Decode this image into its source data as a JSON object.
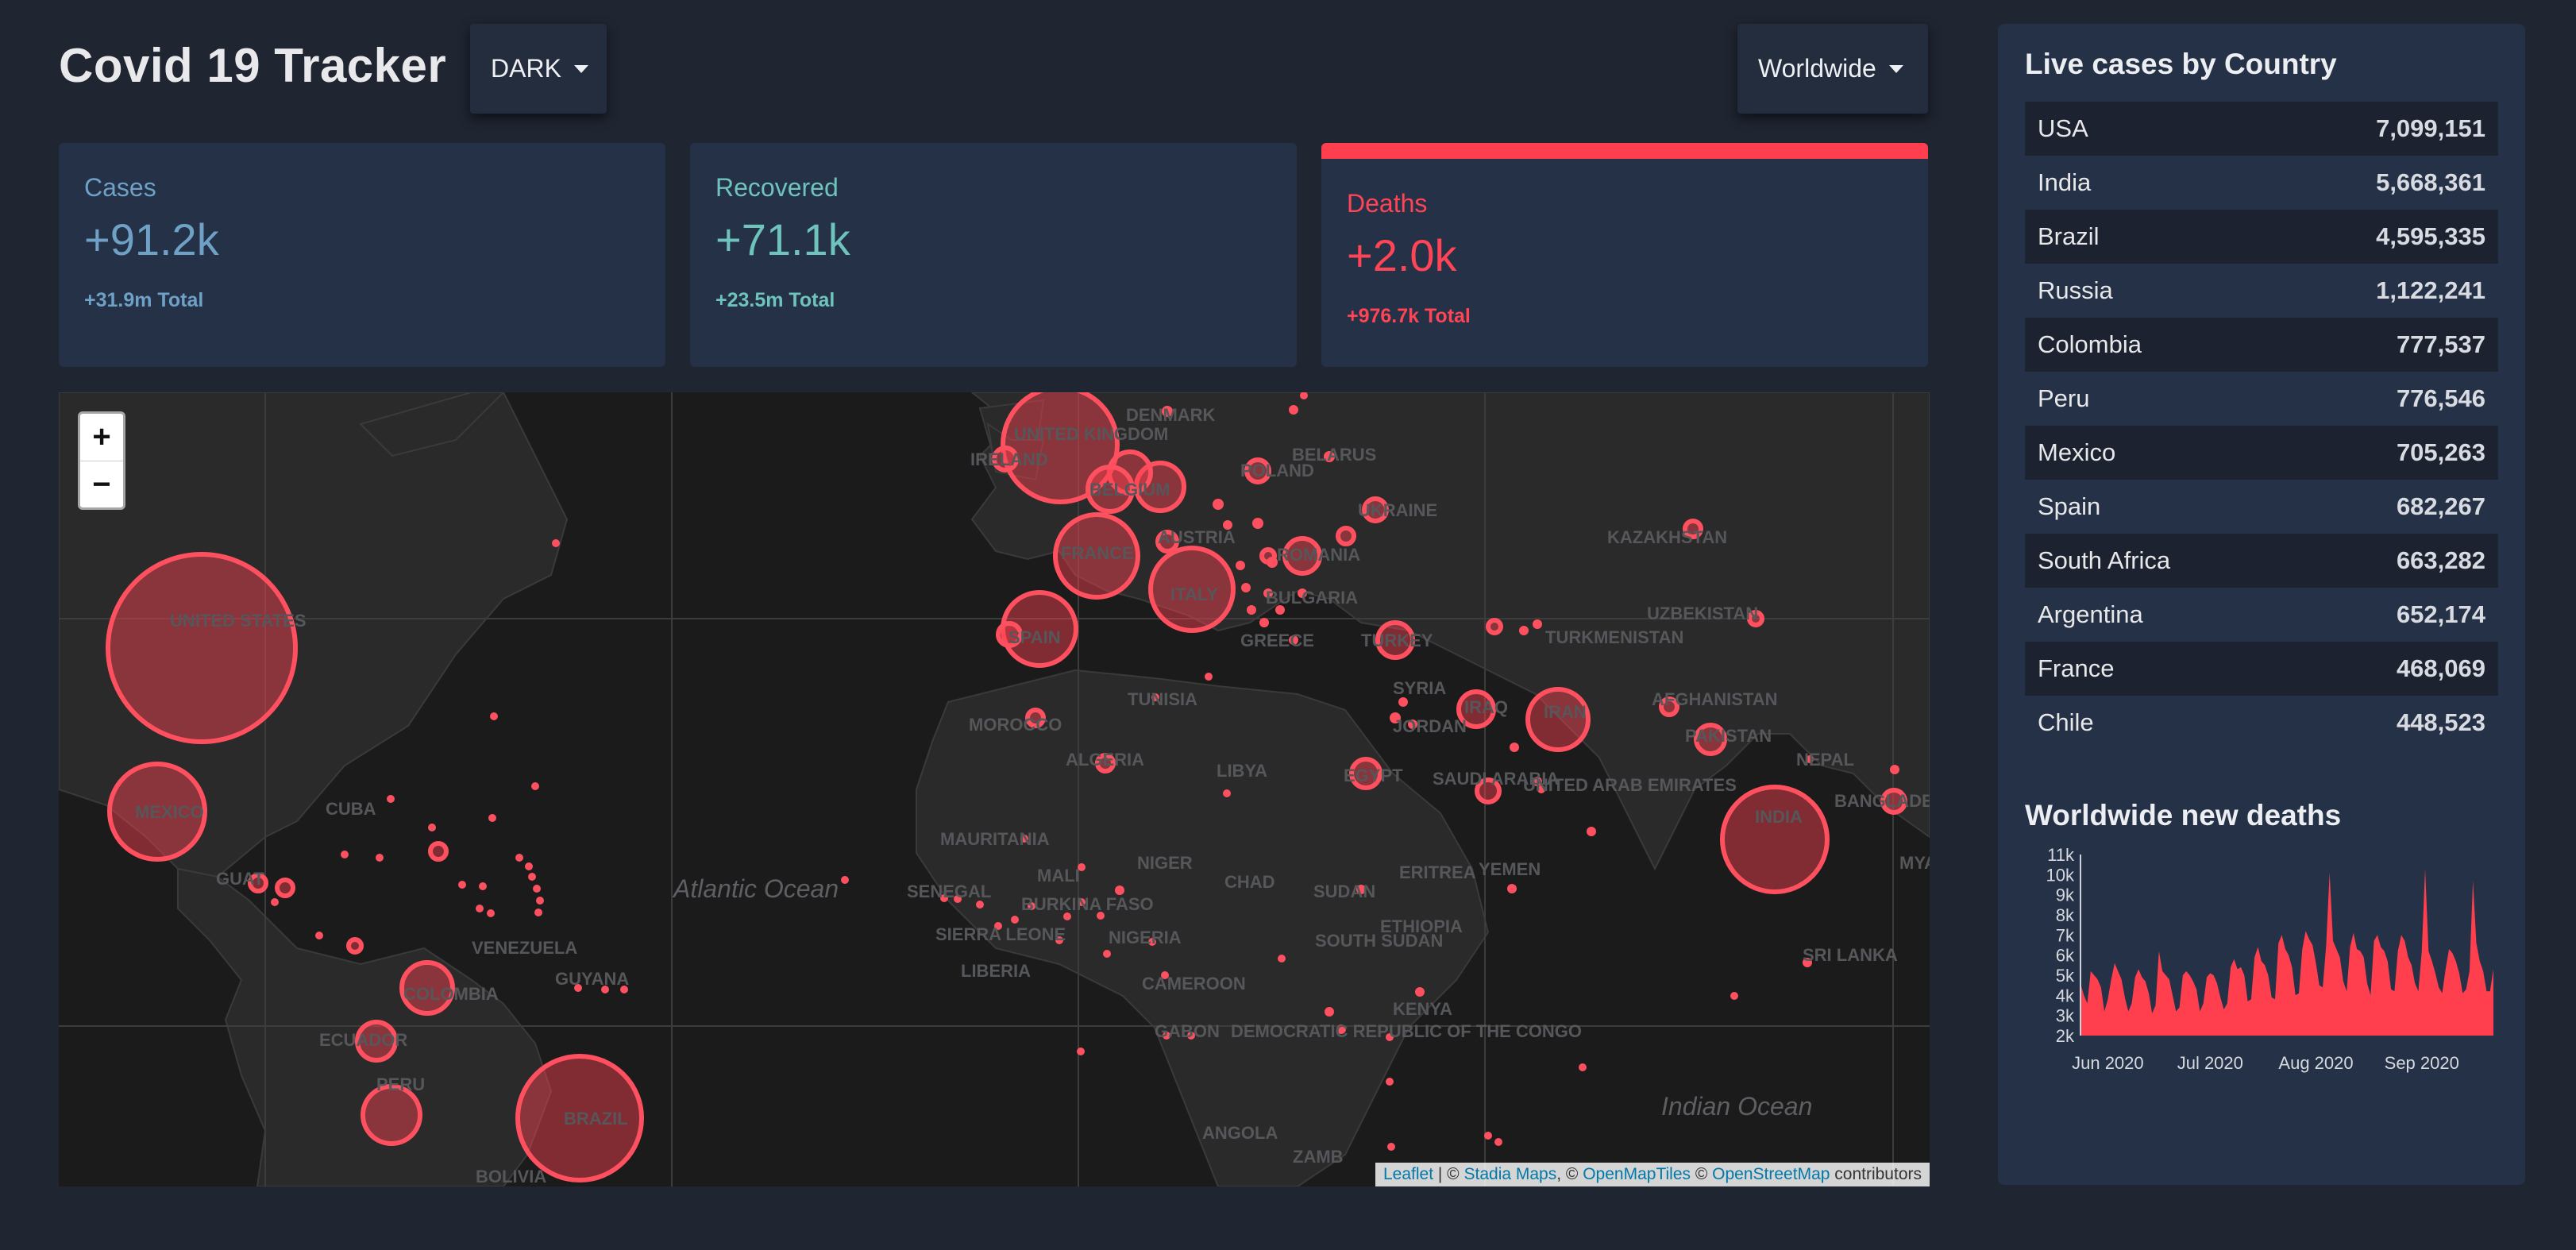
{
  "header": {
    "title": "Covid 19 Tracker",
    "theme_label": "DARK",
    "region_label": "Worldwide"
  },
  "stats": [
    {
      "title": "Cases",
      "value": "+91.2k",
      "total": "+31.9m Total",
      "color": "#6fa1c6"
    },
    {
      "title": "Recovered",
      "value": "+71.1k",
      "total": "+23.5m Total",
      "color": "#6fc3bd"
    },
    {
      "title": "Deaths",
      "value": "+2.0k",
      "total": "+976.7k Total",
      "color": "#ff4455",
      "active": true
    }
  ],
  "map": {
    "zoom_in": "+",
    "zoom_out": "−",
    "attribution": {
      "leaflet": "Leaflet",
      "sep1": " | © ",
      "stadia": "Stadia Maps",
      "sep2": ", © ",
      "openmaptiles": "OpenMapTiles",
      "sep3": " © ",
      "osm": "OpenStreetMap",
      "suffix": " contributors"
    },
    "labels": {
      "us": "UNITED STATES",
      "mexico": "MEXICO",
      "cuba": "CUBA",
      "guatemala": "GUAT",
      "venezuela": "VENEZUELA",
      "guyana": "GUYANA",
      "colombia": "COLOMBIA",
      "ecuador": "ECUADOR",
      "peru": "PERU",
      "brazil": "BRAZIL",
      "bolivia": "BOLIVIA",
      "atlantic": "Atlantic Ocean",
      "indian": "Indian Ocean",
      "uk": "UNITED KINGDOM",
      "ireland": "IRELAND",
      "denmark": "DENMARK",
      "belgium": "BELGIUM",
      "poland": "POLAND",
      "belarus": "BELARUS",
      "ukraine": "UKRAINE",
      "france": "FRANCE",
      "austria": "AUSTRIA",
      "romania": "ROMANIA",
      "italy": "ITALY",
      "bulgaria": "BULGARIA",
      "spain": "SPAIN",
      "greece": "GREECE",
      "turkey": "TURKEY",
      "syria": "SYRIA",
      "iraq": "IRAQ",
      "iran": "IRAN",
      "jordan": "JORDAN",
      "morocco": "MOROCCO",
      "tunisia": "TUNISIA",
      "algeria": "ALGERIA",
      "libya": "LIBYA",
      "egypt": "EGYPT",
      "saudi": "SAUDI ARABIA",
      "uae": "UNITED ARAB EMIRATES",
      "yemen": "YEMEN",
      "eritrea": "ERITREA",
      "mauritania": "MAURITANIA",
      "mali": "MALI",
      "niger": "NIGER",
      "chad": "CHAD",
      "sudan": "SUDAN",
      "senegal": "SENEGAL",
      "burkina": "BURKINA FASO",
      "sierra": "SIERRA LEONE",
      "liberia": "LIBERIA",
      "nigeria": "NIGERIA",
      "southsudan": "SOUTH SUDAN",
      "ethiopia": "ETHIOPIA",
      "cameroon": "CAMEROON",
      "gabon": "GABON",
      "drc": "DEMOCRATIC REPUBLIC OF THE CONGO",
      "kenya": "KENYA",
      "angola": "ANGOLA",
      "zambia": "ZAMB",
      "kazakhstan": "KAZAKHSTAN",
      "uzbekistan": "UZBEKISTAN",
      "turkmenistan": "TURKMENISTAN",
      "afghanistan": "AFGHANISTAN",
      "pakistan": "PAKISTAN",
      "nepal": "NEPAL",
      "india": "INDIA",
      "bangladesh": "BANGLADESH",
      "srilanka": "SRI LANKA",
      "myanmar": "MYA"
    }
  },
  "sidebar": {
    "title": "Live cases by Country",
    "countries": [
      {
        "name": "USA",
        "cases": "7,099,151"
      },
      {
        "name": "India",
        "cases": "5,668,361"
      },
      {
        "name": "Brazil",
        "cases": "4,595,335"
      },
      {
        "name": "Russia",
        "cases": "1,122,241"
      },
      {
        "name": "Colombia",
        "cases": "777,537"
      },
      {
        "name": "Peru",
        "cases": "776,546"
      },
      {
        "name": "Mexico",
        "cases": "705,263"
      },
      {
        "name": "Spain",
        "cases": "682,267"
      },
      {
        "name": "South Africa",
        "cases": "663,282"
      },
      {
        "name": "Argentina",
        "cases": "652,174"
      },
      {
        "name": "France",
        "cases": "468,069"
      },
      {
        "name": "Chile",
        "cases": "448,523"
      }
    ],
    "chart_title": "Worldwide new deaths"
  },
  "colors": {
    "accent": "#ff3f4e",
    "background": "#1f2531",
    "panel": "#243147"
  },
  "chart_data": {
    "type": "area",
    "title": "Worldwide new deaths",
    "xlabel": "",
    "ylabel": "",
    "x_ticks": [
      "Jun 2020",
      "Jul 2020",
      "Aug 2020",
      "Sep 2020"
    ],
    "y_ticks": [
      "2k",
      "3k",
      "4k",
      "5k",
      "6k",
      "7k",
      "8k",
      "9k",
      "10k",
      "11k"
    ],
    "ylim": [
      2000,
      11000
    ],
    "x": [
      "2020-05-24",
      "2020-05-25",
      "2020-05-26",
      "2020-05-27",
      "2020-05-28",
      "2020-05-29",
      "2020-05-30",
      "2020-05-31",
      "2020-06-01",
      "2020-06-02",
      "2020-06-03",
      "2020-06-04",
      "2020-06-05",
      "2020-06-06",
      "2020-06-07",
      "2020-06-08",
      "2020-06-09",
      "2020-06-10",
      "2020-06-11",
      "2020-06-12",
      "2020-06-13",
      "2020-06-14",
      "2020-06-15",
      "2020-06-16",
      "2020-06-17",
      "2020-06-18",
      "2020-06-19",
      "2020-06-20",
      "2020-06-21",
      "2020-06-22",
      "2020-06-23",
      "2020-06-24",
      "2020-06-25",
      "2020-06-26",
      "2020-06-27",
      "2020-06-28",
      "2020-06-29",
      "2020-06-30",
      "2020-07-01",
      "2020-07-02",
      "2020-07-03",
      "2020-07-04",
      "2020-07-05",
      "2020-07-06",
      "2020-07-07",
      "2020-07-08",
      "2020-07-09",
      "2020-07-10",
      "2020-07-11",
      "2020-07-12",
      "2020-07-13",
      "2020-07-14",
      "2020-07-15",
      "2020-07-16",
      "2020-07-17",
      "2020-07-18",
      "2020-07-19",
      "2020-07-20",
      "2020-07-21",
      "2020-07-22",
      "2020-07-23",
      "2020-07-24",
      "2020-07-25",
      "2020-07-26",
      "2020-07-27",
      "2020-07-28",
      "2020-07-29",
      "2020-07-30",
      "2020-07-31",
      "2020-08-01",
      "2020-08-02",
      "2020-08-03",
      "2020-08-04",
      "2020-08-05",
      "2020-08-06",
      "2020-08-07",
      "2020-08-08",
      "2020-08-09",
      "2020-08-10",
      "2020-08-11",
      "2020-08-12",
      "2020-08-13",
      "2020-08-14",
      "2020-08-15",
      "2020-08-16",
      "2020-08-17",
      "2020-08-18",
      "2020-08-19",
      "2020-08-20",
      "2020-08-21",
      "2020-08-22",
      "2020-08-23",
      "2020-08-24",
      "2020-08-25",
      "2020-08-26",
      "2020-08-27",
      "2020-08-28",
      "2020-08-29",
      "2020-08-30",
      "2020-08-31",
      "2020-09-01",
      "2020-09-02",
      "2020-09-03",
      "2020-09-04",
      "2020-09-05",
      "2020-09-06",
      "2020-09-07",
      "2020-09-08",
      "2020-09-09",
      "2020-09-10",
      "2020-09-11",
      "2020-09-12",
      "2020-09-13",
      "2020-09-14",
      "2020-09-15",
      "2020-09-16",
      "2020-09-17",
      "2020-09-18",
      "2020-09-19",
      "2020-09-20",
      "2020-09-21",
      "2020-09-22"
    ],
    "values": [
      4600,
      4000,
      3600,
      5200,
      5000,
      4800,
      4400,
      3200,
      3800,
      4800,
      5600,
      5200,
      4800,
      3900,
      3200,
      3600,
      4900,
      5300,
      4900,
      4700,
      4100,
      3100,
      3500,
      6200,
      5200,
      5000,
      4800,
      4000,
      3200,
      3400,
      5000,
      5200,
      5000,
      4700,
      4300,
      3200,
      3600,
      4900,
      5100,
      5000,
      4600,
      3900,
      3300,
      3600,
      5400,
      5800,
      5300,
      5400,
      5000,
      3700,
      3800,
      5900,
      6400,
      5700,
      5500,
      5000,
      3900,
      3800,
      6600,
      7000,
      6300,
      6000,
      5400,
      4000,
      4100,
      6300,
      7200,
      6800,
      6500,
      5600,
      4500,
      4400,
      6500,
      10100,
      6700,
      6300,
      5900,
      4700,
      4200,
      6400,
      7100,
      6300,
      6200,
      5900,
      4600,
      4000,
      6700,
      7000,
      6400,
      6200,
      5700,
      4300,
      4200,
      6200,
      7000,
      6700,
      5900,
      5500,
      4600,
      4200,
      6200,
      10300,
      6200,
      5700,
      5100,
      4400,
      4100,
      5300,
      6300,
      6100,
      5700,
      5100,
      4100,
      4300,
      5200,
      9700,
      6600,
      5700,
      5200,
      4200,
      4200,
      5300,
      5700
    ]
  }
}
